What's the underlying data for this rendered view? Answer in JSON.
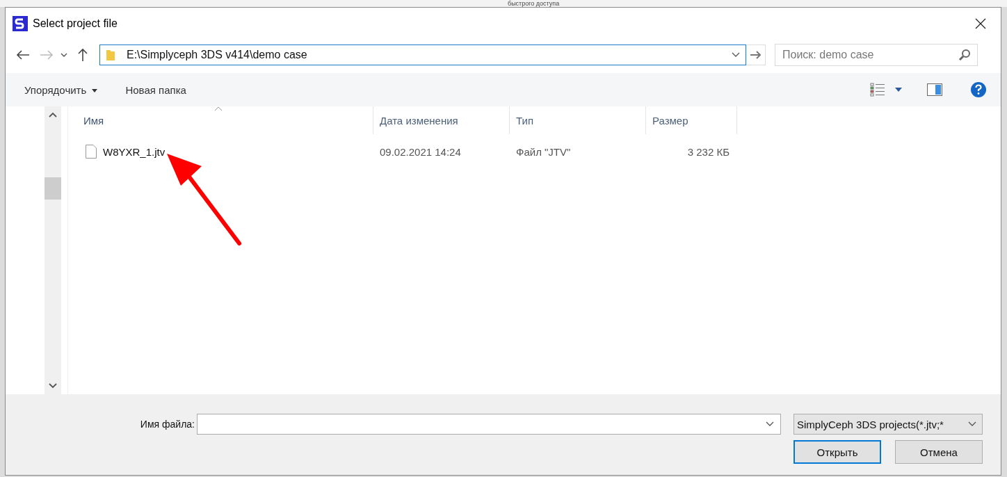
{
  "background": {
    "text": "быстрого доступа"
  },
  "window": {
    "title": "Select project file"
  },
  "address": {
    "path": "E:\\Simplyceph 3DS v414\\demo case"
  },
  "search": {
    "placeholder": "Поиск: demo case"
  },
  "toolbar": {
    "organize": "Упорядочить",
    "new_folder": "Новая папка"
  },
  "table": {
    "columns": [
      {
        "label": "Имя",
        "sorted": true
      },
      {
        "label": "Дата изменения",
        "sorted": false
      },
      {
        "label": "Тип",
        "sorted": false
      },
      {
        "label": "Размер",
        "sorted": false
      }
    ],
    "rows": [
      {
        "name": "W8YXR_1.jtv",
        "date": "09.02.2021 14:24",
        "type": "Файл \"JTV\"",
        "size": "3 232 КБ",
        "selected": false
      }
    ]
  },
  "filename": {
    "label": "Имя файла:"
  },
  "filter": {
    "value": "SimplyCeph 3DS projects(*.jtv;*"
  },
  "buttons": [
    {
      "label": "Открыть",
      "kind": "default"
    },
    {
      "label": "Отмена",
      "kind": "normal"
    }
  ]
}
